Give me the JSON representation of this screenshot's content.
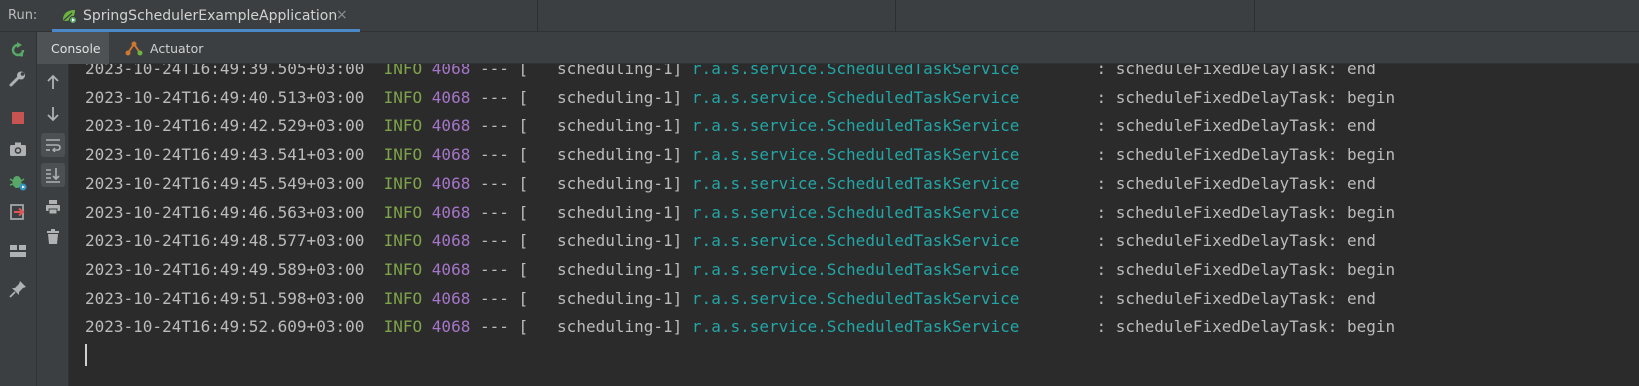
{
  "run_bar": {
    "label": "Run:",
    "tab_label": "SpringSchedulerExampleApplication",
    "close_symbol": "×",
    "tab_icon": "spring-leaf-run-icon"
  },
  "colors": {
    "accent": "#4a88c7",
    "level_info": "#7fa34b",
    "pid": "#a575c9",
    "logger": "#23a6a6",
    "text": "#bbbbbb",
    "background": "#2b2b2b",
    "panel": "#3c3f41"
  },
  "left_toolbar": [
    {
      "name": "rerun-icon"
    },
    {
      "name": "wrench-icon"
    },
    {
      "name": "stop-icon"
    },
    {
      "name": "camera-icon"
    },
    {
      "name": "debug-bug-icon"
    },
    {
      "name": "exit-icon"
    },
    {
      "name": "layout-icon"
    },
    {
      "name": "pin-icon"
    }
  ],
  "subtabs": {
    "console": "Console",
    "actuator": "Actuator"
  },
  "console_toolbar": [
    {
      "name": "scroll-up-icon"
    },
    {
      "name": "scroll-down-icon"
    },
    {
      "name": "soft-wrap-icon"
    },
    {
      "name": "scroll-to-end-icon"
    },
    {
      "name": "print-icon"
    },
    {
      "name": "trash-icon"
    }
  ],
  "console": {
    "lines": [
      {
        "ts": "2023-10-24T16:49:39.505+03:00",
        "level": "INFO",
        "pid": "4068",
        "sep": "---",
        "thread": "[   scheduling-1]",
        "logger": "r.a.s.service.ScheduledTaskService",
        "msg": ": scheduleFixedDelayTask: end"
      },
      {
        "ts": "2023-10-24T16:49:40.513+03:00",
        "level": "INFO",
        "pid": "4068",
        "sep": "---",
        "thread": "[   scheduling-1]",
        "logger": "r.a.s.service.ScheduledTaskService",
        "msg": ": scheduleFixedDelayTask: begin"
      },
      {
        "ts": "2023-10-24T16:49:42.529+03:00",
        "level": "INFO",
        "pid": "4068",
        "sep": "---",
        "thread": "[   scheduling-1]",
        "logger": "r.a.s.service.ScheduledTaskService",
        "msg": ": scheduleFixedDelayTask: end"
      },
      {
        "ts": "2023-10-24T16:49:43.541+03:00",
        "level": "INFO",
        "pid": "4068",
        "sep": "---",
        "thread": "[   scheduling-1]",
        "logger": "r.a.s.service.ScheduledTaskService",
        "msg": ": scheduleFixedDelayTask: begin"
      },
      {
        "ts": "2023-10-24T16:49:45.549+03:00",
        "level": "INFO",
        "pid": "4068",
        "sep": "---",
        "thread": "[   scheduling-1]",
        "logger": "r.a.s.service.ScheduledTaskService",
        "msg": ": scheduleFixedDelayTask: end"
      },
      {
        "ts": "2023-10-24T16:49:46.563+03:00",
        "level": "INFO",
        "pid": "4068",
        "sep": "---",
        "thread": "[   scheduling-1]",
        "logger": "r.a.s.service.ScheduledTaskService",
        "msg": ": scheduleFixedDelayTask: begin"
      },
      {
        "ts": "2023-10-24T16:49:48.577+03:00",
        "level": "INFO",
        "pid": "4068",
        "sep": "---",
        "thread": "[   scheduling-1]",
        "logger": "r.a.s.service.ScheduledTaskService",
        "msg": ": scheduleFixedDelayTask: end"
      },
      {
        "ts": "2023-10-24T16:49:49.589+03:00",
        "level": "INFO",
        "pid": "4068",
        "sep": "---",
        "thread": "[   scheduling-1]",
        "logger": "r.a.s.service.ScheduledTaskService",
        "msg": ": scheduleFixedDelayTask: begin"
      },
      {
        "ts": "2023-10-24T16:49:51.598+03:00",
        "level": "INFO",
        "pid": "4068",
        "sep": "---",
        "thread": "[   scheduling-1]",
        "logger": "r.a.s.service.ScheduledTaskService",
        "msg": ": scheduleFixedDelayTask: end"
      },
      {
        "ts": "2023-10-24T16:49:52.609+03:00",
        "level": "INFO",
        "pid": "4068",
        "sep": "---",
        "thread": "[   scheduling-1]",
        "logger": "r.a.s.service.ScheduledTaskService",
        "msg": ": scheduleFixedDelayTask: begin"
      }
    ]
  }
}
